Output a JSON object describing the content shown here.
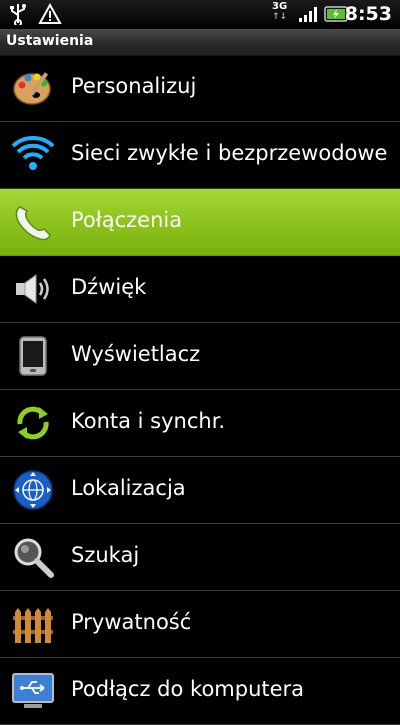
{
  "status_bar": {
    "time": "8:53",
    "network": "3G",
    "icons": [
      "usb-icon",
      "warning-icon",
      "signal-icon",
      "battery-icon"
    ]
  },
  "title": "Ustawienia",
  "colors": {
    "selected_bg": "#8fc51e",
    "divider": "#3a3a3a"
  },
  "items": [
    {
      "label": "Personalizuj",
      "icon": "palette-icon"
    },
    {
      "label": "Sieci zwykłe i bezprzewodowe",
      "icon": "wireless-icon"
    },
    {
      "label": "Połączenia",
      "icon": "phone-handset-icon",
      "selected": true
    },
    {
      "label": "Dźwięk",
      "icon": "speaker-icon"
    },
    {
      "label": "Wyświetlacz",
      "icon": "display-phone-icon"
    },
    {
      "label": "Konta i synchr.",
      "icon": "sync-icon"
    },
    {
      "label": "Lokalizacja",
      "icon": "location-globe-icon"
    },
    {
      "label": "Szukaj",
      "icon": "magnifier-icon"
    },
    {
      "label": "Prywatność",
      "icon": "fence-icon"
    },
    {
      "label": "Podłącz do komputera",
      "icon": "usb-computer-icon"
    }
  ]
}
